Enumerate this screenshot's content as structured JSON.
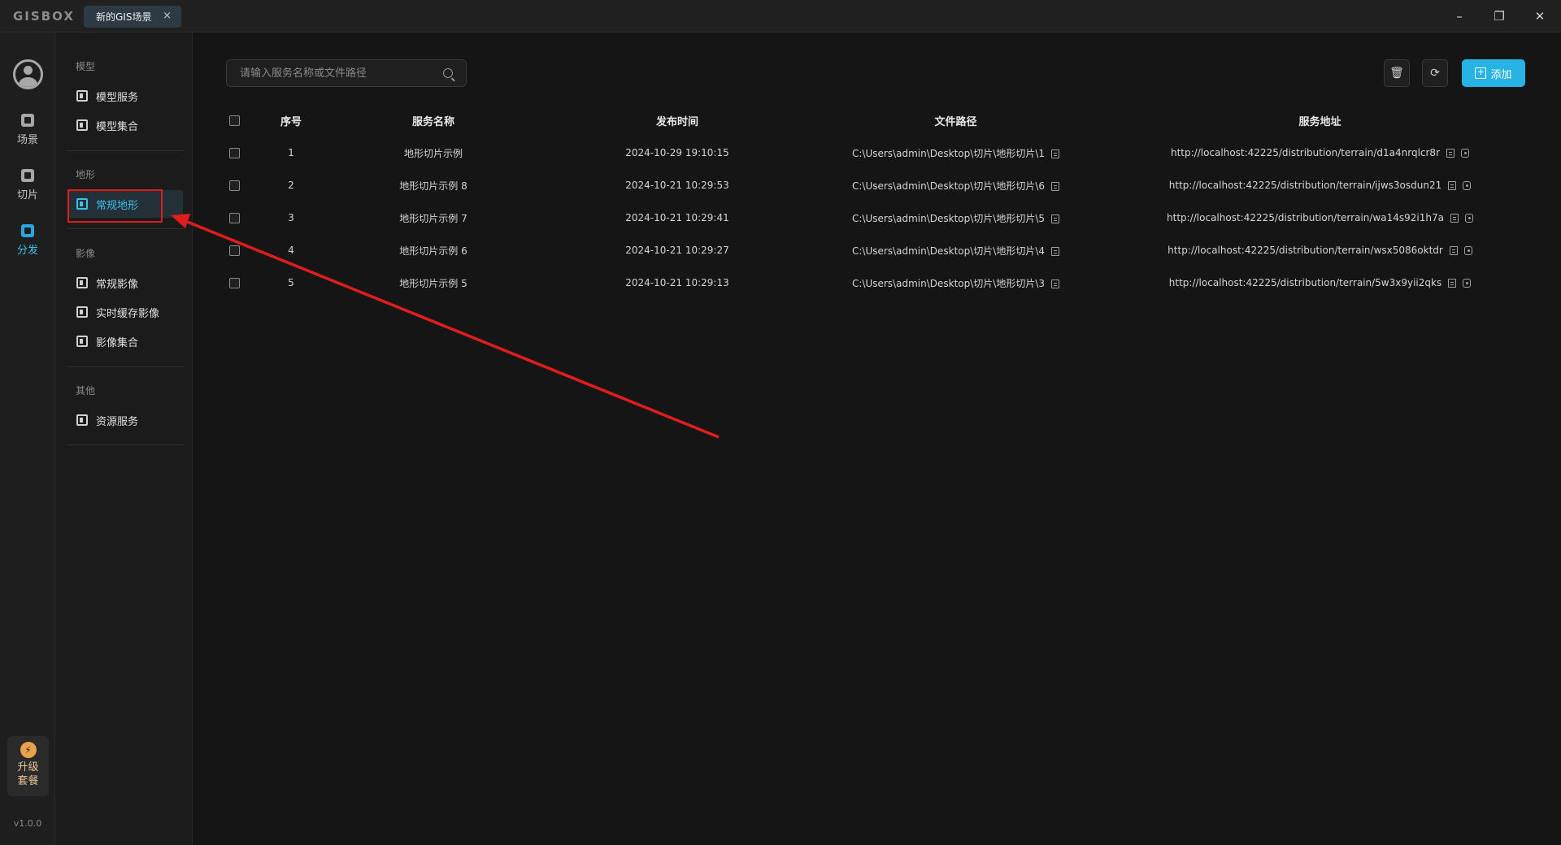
{
  "app": {
    "logo": "GISBOX",
    "version": "v1.0.0"
  },
  "tabs": [
    {
      "label": "新的GIS场景",
      "close": "×"
    }
  ],
  "window_controls": {
    "minimize": "–",
    "restore": "❐",
    "close": "✕"
  },
  "rail": {
    "items": [
      {
        "label": "场景",
        "icon": "home-icon",
        "active": false
      },
      {
        "label": "切片",
        "icon": "slice-icon",
        "active": false
      },
      {
        "label": "分发",
        "icon": "distribute-icon",
        "active": true
      }
    ],
    "upgrade": {
      "line1": "升级",
      "line2": "套餐",
      "icon": "lightning-icon"
    }
  },
  "sidebar": {
    "groups": [
      {
        "title": "模型",
        "items": [
          "模型服务",
          "模型集合"
        ]
      },
      {
        "title": "地形",
        "items": [
          "常规地形"
        ]
      },
      {
        "title": "影像",
        "items": [
          "常规影像",
          "实时缓存影像",
          "影像集合"
        ]
      },
      {
        "title": "其他",
        "items": [
          "资源服务"
        ]
      }
    ],
    "active_item": "常规地形"
  },
  "toolbar": {
    "search_placeholder": "请输入服务名称或文件路径",
    "add_label": "添加",
    "add_plus": "+"
  },
  "table": {
    "columns": [
      "序号",
      "服务名称",
      "发布时间",
      "文件路径",
      "服务地址"
    ],
    "rows": [
      [
        "1",
        "地形切片示例",
        "2024-10-29 19:10:15",
        "C:\\Users\\admin\\Desktop\\切片\\地形切片\\1",
        "http://localhost:42225/distribution/terrain/d1a4nrqlcr8r"
      ],
      [
        "2",
        "地形切片示例 8",
        "2024-10-21 10:29:53",
        "C:\\Users\\admin\\Desktop\\切片\\地形切片\\6",
        "http://localhost:42225/distribution/terrain/ijws3osdun21"
      ],
      [
        "3",
        "地形切片示例 7",
        "2024-10-21 10:29:41",
        "C:\\Users\\admin\\Desktop\\切片\\地形切片\\5",
        "http://localhost:42225/distribution/terrain/wa14s92i1h7a"
      ],
      [
        "4",
        "地形切片示例 6",
        "2024-10-21 10:29:27",
        "C:\\Users\\admin\\Desktop\\切片\\地形切片\\4",
        "http://localhost:42225/distribution/terrain/wsx5086oktdr"
      ],
      [
        "5",
        "地形切片示例 5",
        "2024-10-21 10:29:13",
        "C:\\Users\\admin\\Desktop\\切片\\地形切片\\3",
        "http://localhost:42225/distribution/terrain/5w3x9yii2qks"
      ]
    ]
  },
  "annotation": {
    "color": "#e11c1c"
  }
}
